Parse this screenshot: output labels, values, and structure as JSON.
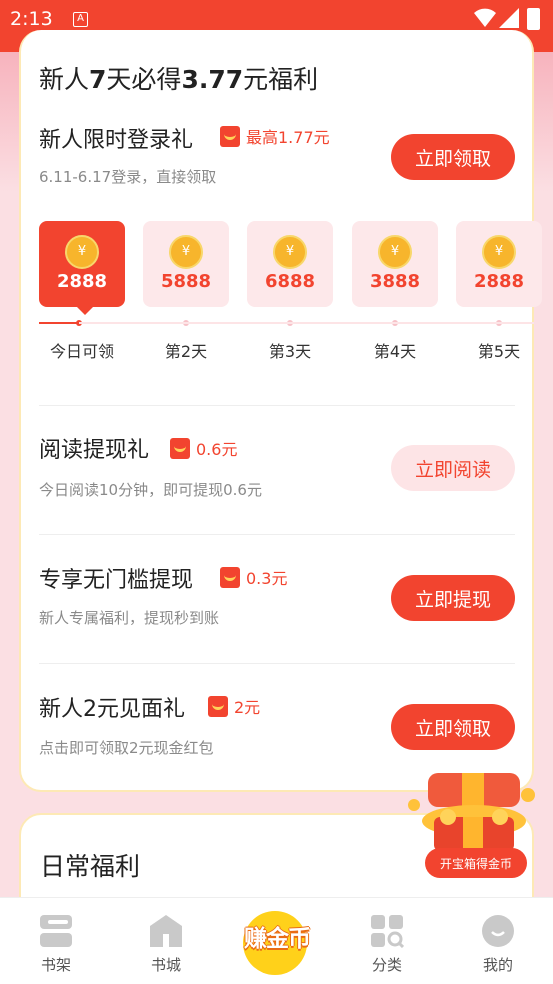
{
  "status": {
    "time": "2:13",
    "notif": "A"
  },
  "header": {
    "title_a": "新人",
    "title_b": "7",
    "title_c": "天必得",
    "title_d": "3.77",
    "title_e": "元福利"
  },
  "login_gift": {
    "title": "新人限时登录礼",
    "badge": "最高1.77元",
    "sub": "6.11-6.17登录，直接领取",
    "button": "立即领取",
    "days": [
      {
        "amount": "2888",
        "label": "今日可领",
        "active": true
      },
      {
        "amount": "5888",
        "label": "第2天",
        "active": false
      },
      {
        "amount": "6888",
        "label": "第3天",
        "active": false
      },
      {
        "amount": "3888",
        "label": "第4天",
        "active": false
      },
      {
        "amount": "2888",
        "label": "第5天",
        "active": false
      }
    ],
    "coin_symbol": "¥"
  },
  "read_gift": {
    "title": "阅读提现礼",
    "badge": "0.6元",
    "sub": "今日阅读10分钟，即可提现0.6元",
    "button": "立即阅读"
  },
  "no_threshold": {
    "title": "专享无门槛提现",
    "badge": "0.3元",
    "sub": "新人专属福利，提现秒到账",
    "button": "立即提现"
  },
  "welcome_gift": {
    "title": "新人2元见面礼",
    "badge": "2元",
    "sub": "点击即可领取2元现金红包",
    "button": "立即领取"
  },
  "treasure": {
    "button": "开宝箱得金币"
  },
  "daily": {
    "title": "日常福利"
  },
  "nav": {
    "items": [
      {
        "label": "书架",
        "icon": "bookshelf-icon"
      },
      {
        "label": "书城",
        "icon": "bookstore-icon"
      },
      {
        "label": "分类",
        "icon": "category-icon"
      },
      {
        "label": "我的",
        "icon": "profile-icon"
      }
    ],
    "earn": "赚金币"
  },
  "colors": {
    "accent": "#f2442f",
    "pink": "#fde4e6",
    "gold": "#f7b52c"
  }
}
